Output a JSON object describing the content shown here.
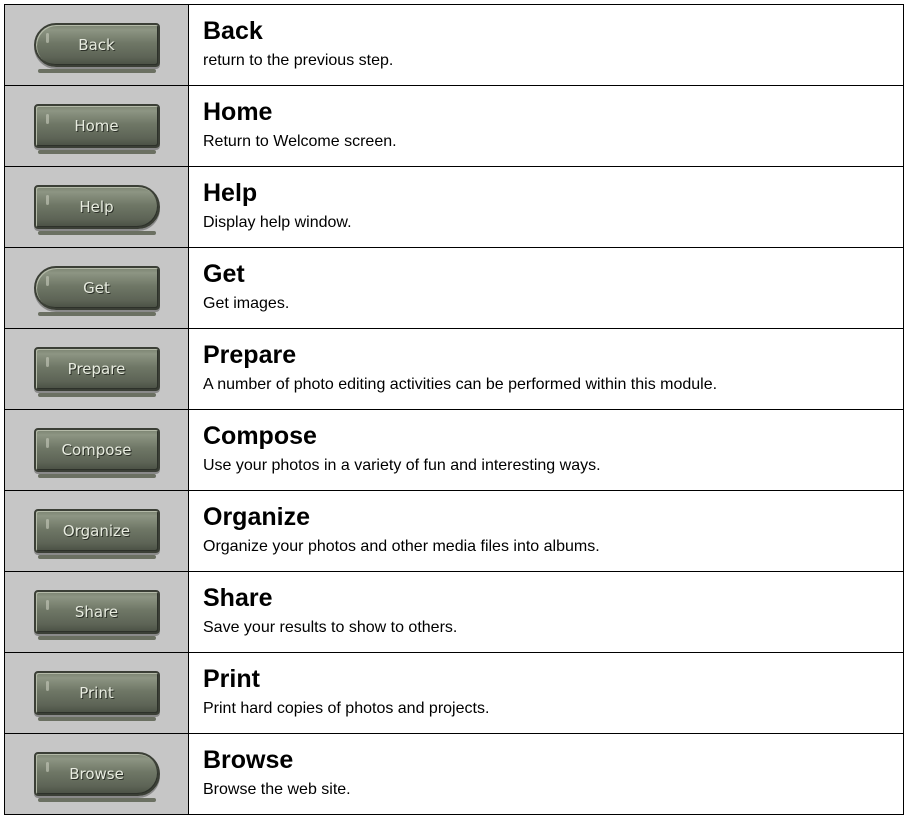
{
  "rows": [
    {
      "button_label": "Back",
      "title": "Back",
      "description": "return to the previous step."
    },
    {
      "button_label": "Home",
      "title": "Home",
      "description": "Return to Welcome screen."
    },
    {
      "button_label": "Help",
      "title": "Help",
      "description": "Display help window."
    },
    {
      "button_label": "Get",
      "title": "Get",
      "description": "Get images."
    },
    {
      "button_label": "Prepare",
      "title": "Prepare",
      "description": "A number of photo editing activities can be performed within this module."
    },
    {
      "button_label": "Compose",
      "title": "Compose",
      "description": "Use your photos in a variety of fun and interesting ways."
    },
    {
      "button_label": "Organize",
      "title": "Organize",
      "description": "Organize your photos and other media files into albums."
    },
    {
      "button_label": "Share",
      "title": "Share",
      "description": "Save your results to show to others."
    },
    {
      "button_label": "Print",
      "title": "Print",
      "description": "Print hard copies of photos and projects."
    },
    {
      "button_label": "Browse",
      "title": "Browse",
      "description": "Browse the web site."
    }
  ]
}
